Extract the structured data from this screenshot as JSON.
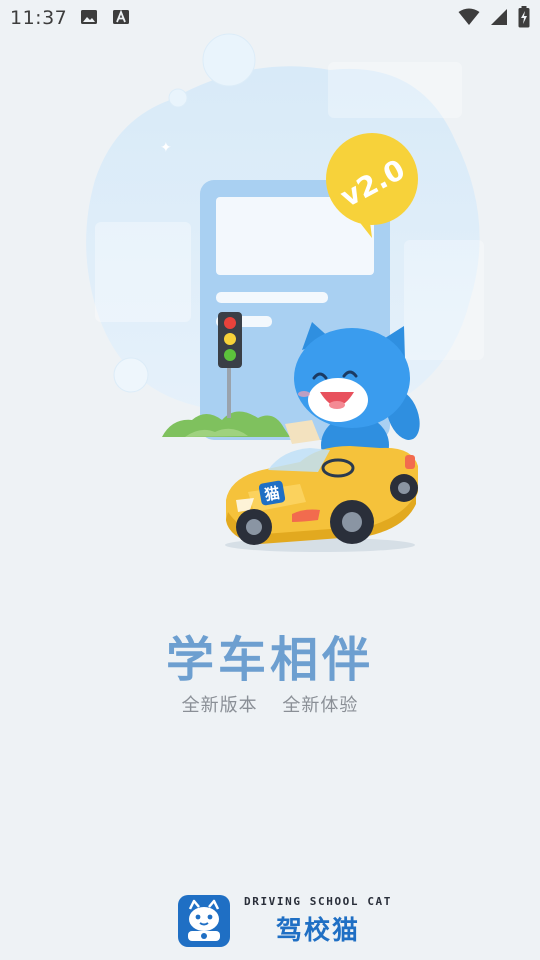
{
  "status_bar": {
    "time": "11:37",
    "left_icons": [
      "image-icon",
      "text-a-icon"
    ],
    "right_icons": [
      "wifi-icon",
      "signal-icon",
      "battery-charging-icon"
    ]
  },
  "illustration": {
    "badge_text": "v2.0",
    "car_plate_text": "猫"
  },
  "main": {
    "title": "学车相伴",
    "subtitle_part1": "全新版本",
    "subtitle_part2": "全新体验"
  },
  "brand": {
    "english_name": "DRIVING SCHOOL CAT",
    "chinese_name": "驾校猫"
  },
  "colors": {
    "background": "#eef2f5",
    "title_blue": "#6d9fd0",
    "brand_blue": "#1f6fc4",
    "badge_yellow": "#f7d23a",
    "car_yellow": "#f5c23b"
  }
}
